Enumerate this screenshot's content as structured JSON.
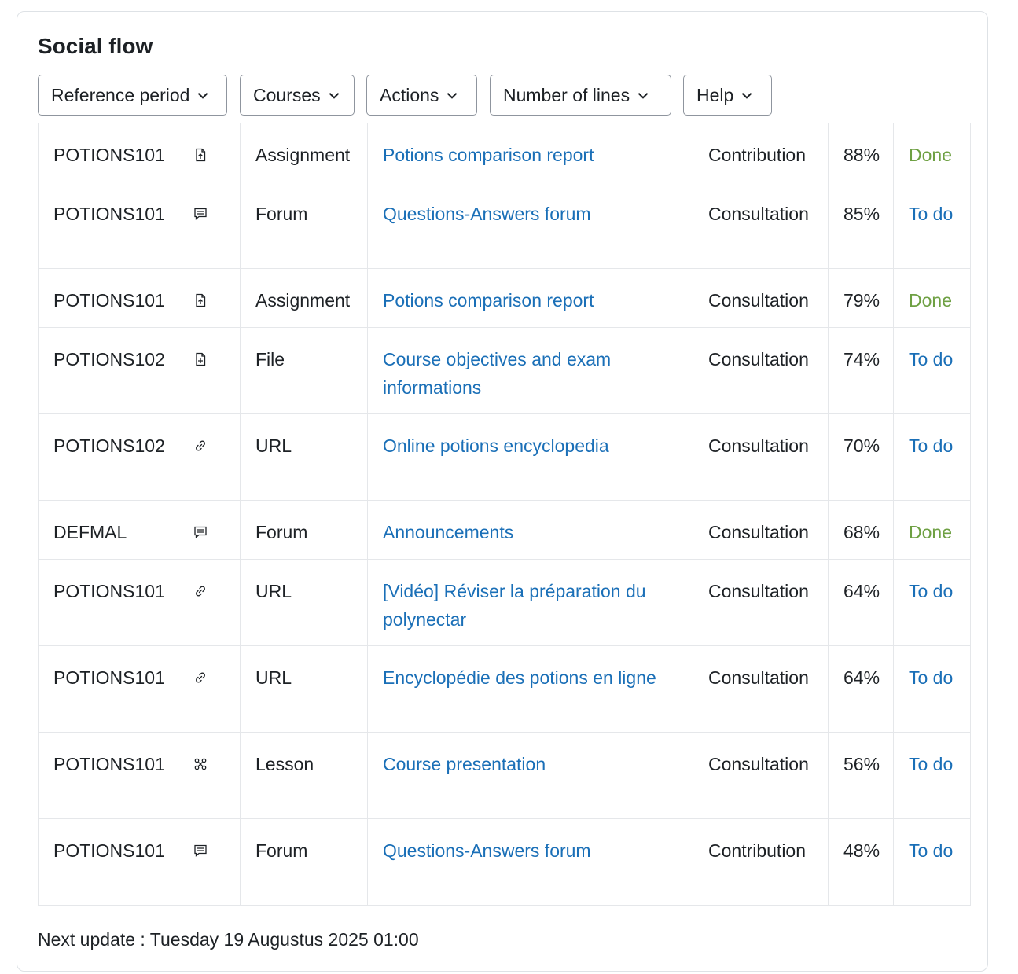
{
  "title": "Social flow",
  "toolbar": {
    "reference_period": "Reference period",
    "courses": "Courses",
    "actions": "Actions",
    "number_of_lines": "Number of lines",
    "help": "Help"
  },
  "rows": [
    {
      "course": "POTIONS101",
      "icon": "assignment-icon",
      "type": "Assignment",
      "title": "Potions comparison report",
      "kind": "Contribution",
      "pct": "88%",
      "status": "Done"
    },
    {
      "course": "POTIONS101",
      "icon": "forum-icon",
      "type": "Forum",
      "title": "Questions-Answers forum",
      "kind": "Consultation",
      "pct": "85%",
      "status": "To do"
    },
    {
      "course": "POTIONS101",
      "icon": "assignment-icon",
      "type": "Assignment",
      "title": "Potions comparison report",
      "kind": "Consultation",
      "pct": "79%",
      "status": "Done"
    },
    {
      "course": "POTIONS102",
      "icon": "file-icon",
      "type": "File",
      "title": "Course objectives and exam informations",
      "kind": "Consultation",
      "pct": "74%",
      "status": "To do"
    },
    {
      "course": "POTIONS102",
      "icon": "link-icon",
      "type": "URL",
      "title": "Online potions encyclopedia",
      "kind": "Consultation",
      "pct": "70%",
      "status": "To do"
    },
    {
      "course": "DEFMAL",
      "icon": "forum-icon",
      "type": "Forum",
      "title": "Announcements",
      "kind": "Consultation",
      "pct": "68%",
      "status": "Done"
    },
    {
      "course": "POTIONS101",
      "icon": "link-icon",
      "type": "URL",
      "title": "[Vidéo] Réviser la préparation du polynectar",
      "kind": "Consultation",
      "pct": "64%",
      "status": "To do"
    },
    {
      "course": "POTIONS101",
      "icon": "link-icon",
      "type": "URL",
      "title": "Encyclopédie des potions en ligne",
      "kind": "Consultation",
      "pct": "64%",
      "status": "To do"
    },
    {
      "course": "POTIONS101",
      "icon": "lesson-icon",
      "type": "Lesson",
      "title": "Course presentation",
      "kind": "Consultation",
      "pct": "56%",
      "status": "To do"
    },
    {
      "course": "POTIONS101",
      "icon": "forum-icon",
      "type": "Forum",
      "title": "Questions-Answers forum",
      "kind": "Contribution",
      "pct": "48%",
      "status": "To do"
    }
  ],
  "footer": "Next update : Tuesday 19 Augustus 2025 01:00",
  "colors": {
    "link": "#1a6fb7",
    "done": "#6ea043",
    "border": "#e5e7ea"
  }
}
